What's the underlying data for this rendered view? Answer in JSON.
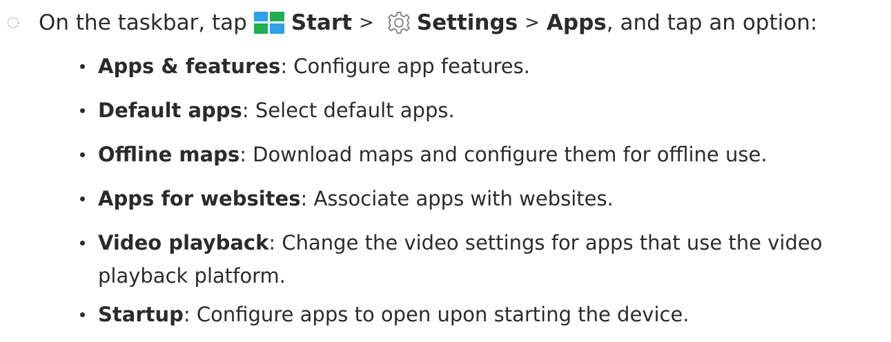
{
  "step": {
    "bullet_icon": "dotted-circle-icon",
    "intro": "On the taskbar, tap",
    "start_icon": "windows-start-icon",
    "start_label": "Start",
    "separator_1": ">",
    "settings_icon": "gear-icon",
    "settings_label": "Settings",
    "separator_2": ">",
    "apps_label": "Apps",
    "outro": ", and tap an option:"
  },
  "items": [
    {
      "term": "Apps & features",
      "colon": ":",
      "desc": " Configure app features."
    },
    {
      "term": "Default apps",
      "colon": ":",
      "desc": " Select default apps."
    },
    {
      "term": "Offline maps",
      "colon": ":",
      "desc": " Download maps and configure them for offline use."
    },
    {
      "term": "Apps for websites",
      "colon": ":",
      "desc": " Associate apps with websites."
    },
    {
      "term": "Video playback",
      "colon": ":",
      "desc": " Change the video settings for apps that use the video",
      "desc_continued": "playback platform."
    },
    {
      "term": "Startup",
      "colon": ":",
      "desc": " Configure apps to open upon starting the device."
    }
  ],
  "colors": {
    "text": "#2b2b2b",
    "windows_blue": "#2ea0e8",
    "windows_green": "#1fae52",
    "icon_gray": "#8a8a8a"
  }
}
